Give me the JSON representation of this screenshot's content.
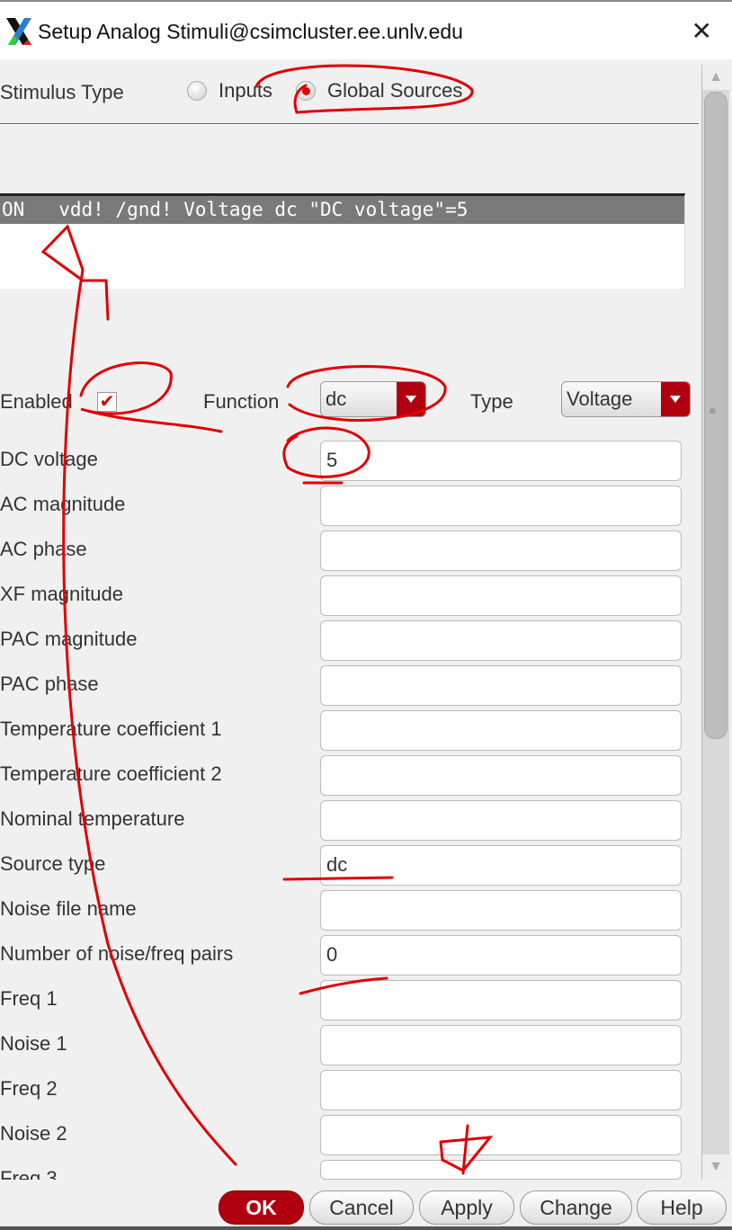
{
  "window": {
    "title": "Setup Analog Stimuli@csimcluster.ee.unlv.edu",
    "close_icon": "close-icon"
  },
  "stimulus_type": {
    "label": "Stimulus Type",
    "options": [
      "Inputs",
      "Global Sources"
    ],
    "selected": "Global Sources"
  },
  "stimuli_list": {
    "selected_row": "ON   vdd! /gnd! Voltage dc \"DC voltage\"=5"
  },
  "controls": {
    "enabled_label": "Enabled",
    "enabled": true,
    "function_label": "Function",
    "function_value": "dc",
    "type_label": "Type",
    "type_value": "Voltage"
  },
  "fields": [
    {
      "label": "DC voltage",
      "value": "5"
    },
    {
      "label": "AC magnitude",
      "value": ""
    },
    {
      "label": "AC phase",
      "value": ""
    },
    {
      "label": "XF magnitude",
      "value": ""
    },
    {
      "label": "PAC magnitude",
      "value": ""
    },
    {
      "label": "PAC phase",
      "value": ""
    },
    {
      "label": "Temperature coefficient 1",
      "value": ""
    },
    {
      "label": "Temperature coefficient 2",
      "value": ""
    },
    {
      "label": "Nominal temperature",
      "value": ""
    },
    {
      "label": "Source type",
      "value": "dc"
    },
    {
      "label": "Noise file name",
      "value": ""
    },
    {
      "label": "Number of noise/freq pairs",
      "value": "0"
    },
    {
      "label": "Freq 1",
      "value": ""
    },
    {
      "label": "Noise 1",
      "value": ""
    },
    {
      "label": "Freq 2",
      "value": ""
    },
    {
      "label": "Noise 2",
      "value": ""
    },
    {
      "label": "Freq 3",
      "value": ""
    }
  ],
  "buttons": {
    "ok": "OK",
    "cancel": "Cancel",
    "apply": "Apply",
    "change": "Change",
    "help": "Help"
  },
  "colors": {
    "accent": "#b00010",
    "annotation": "#e00000",
    "selection": "#7a7a7a"
  }
}
